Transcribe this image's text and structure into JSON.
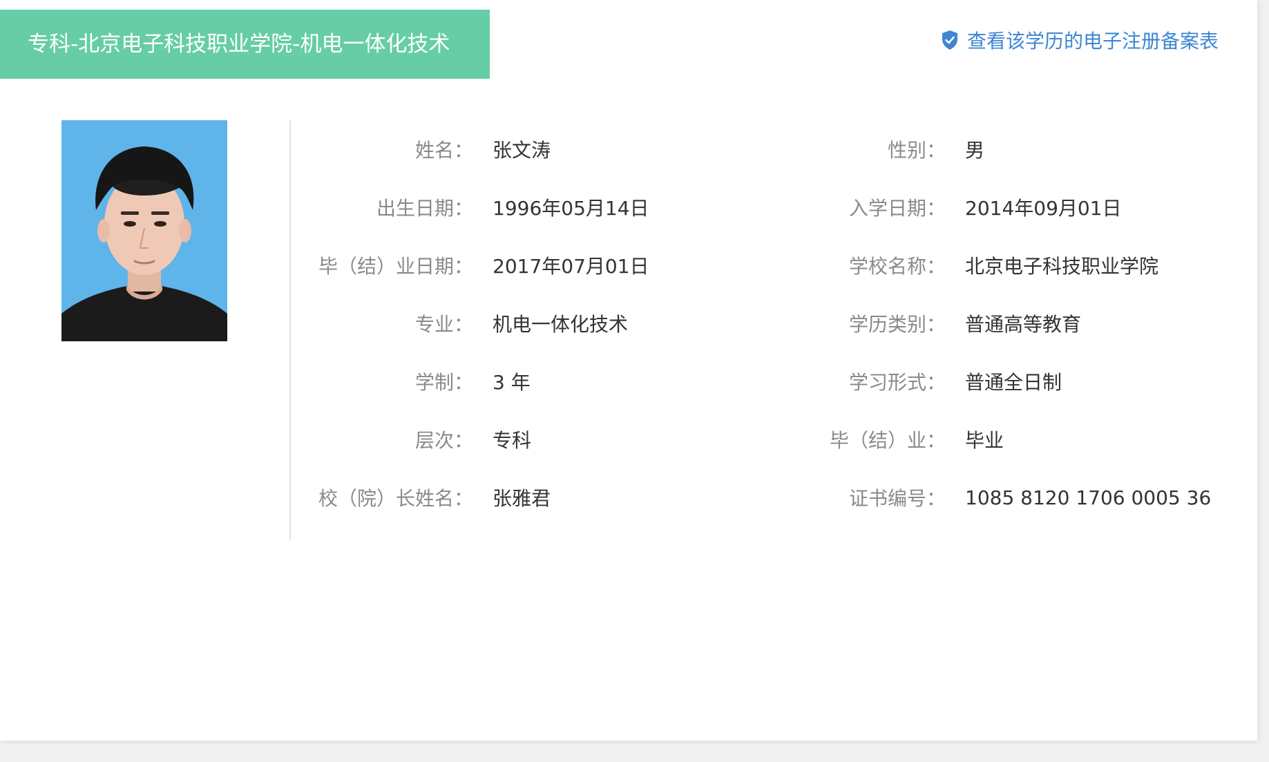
{
  "header": {
    "title": "专科-北京电子科技职业学院-机电一体化技术",
    "record_link": "查看该学历的电子注册备案表",
    "banner_color": "#66cda6",
    "link_color": "#3f86d1"
  },
  "fields": [
    {
      "label": "姓名：",
      "value": "张文涛"
    },
    {
      "label": "性别：",
      "value": "男"
    },
    {
      "label": "出生日期：",
      "value": "1996年05月14日"
    },
    {
      "label": "入学日期：",
      "value": "2014年09月01日"
    },
    {
      "label": "毕（结）业日期：",
      "value": "2017年07月01日"
    },
    {
      "label": "学校名称：",
      "value": "北京电子科技职业学院"
    },
    {
      "label": "专业：",
      "value": "机电一体化技术"
    },
    {
      "label": "学历类别：",
      "value": "普通高等教育"
    },
    {
      "label": "学制：",
      "value": "3 年"
    },
    {
      "label": "学习形式：",
      "value": "普通全日制"
    },
    {
      "label": "层次：",
      "value": "专科"
    },
    {
      "label": "毕（结）业：",
      "value": "毕业"
    },
    {
      "label": "校（院）长姓名：",
      "value": "张雅君"
    },
    {
      "label": "证书编号：",
      "value": "1085 8120 1706 0005 36"
    }
  ],
  "icons": {
    "record_link_icon": "shield-check-icon"
  }
}
